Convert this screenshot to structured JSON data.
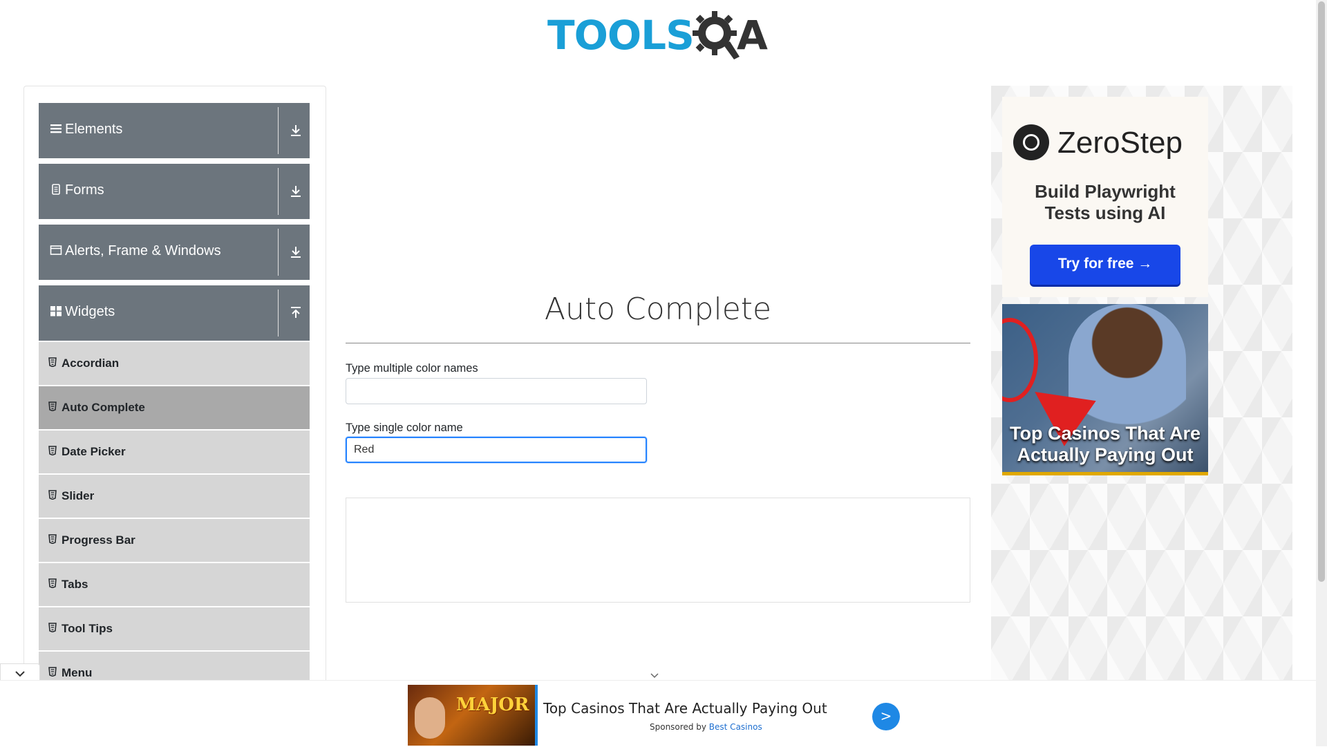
{
  "header": {
    "logo_text": "TOOLS",
    "logo_suffix": "A"
  },
  "sidebar": {
    "groups": [
      {
        "label": "Elements",
        "icon": "hamburger-icon",
        "expanded": false
      },
      {
        "label": "Forms",
        "icon": "document-icon",
        "expanded": false
      },
      {
        "label": "Alerts, Frame & Windows",
        "icon": "window-icon",
        "expanded": false
      },
      {
        "label": "Widgets",
        "icon": "grid-icon",
        "expanded": true
      }
    ],
    "items": [
      {
        "label": "Accordian",
        "active": false
      },
      {
        "label": "Auto Complete",
        "active": true
      },
      {
        "label": "Date Picker",
        "active": false
      },
      {
        "label": "Slider",
        "active": false
      },
      {
        "label": "Progress Bar",
        "active": false
      },
      {
        "label": "Tabs",
        "active": false
      },
      {
        "label": "Tool Tips",
        "active": false
      },
      {
        "label": "Menu",
        "active": false
      }
    ]
  },
  "main": {
    "title": "Auto Complete",
    "multi": {
      "label": "Type multiple color names",
      "value": ""
    },
    "single": {
      "label": "Type single color name",
      "value": "Red"
    }
  },
  "right_ads": {
    "zerostep": {
      "name": "ZeroStep",
      "tagline_line1": "Build Playwright",
      "tagline_line2": "Tests using AI",
      "button": "Try for free →"
    },
    "casino": {
      "line1": "Top Casinos That Are",
      "line2": "Actually Paying Out"
    }
  },
  "bottom_ad": {
    "thumb_text": "MAJOR",
    "title": "Top Casinos That Are Actually Paying Out",
    "sponsored_prefix": "Sponsored by",
    "sponsor": "Best Casinos",
    "go_label": ">"
  },
  "colors": {
    "brand_blue": "#1a9fd7",
    "sidebar_group": "#6c757d",
    "sidebar_item": "#d6d6d6",
    "sidebar_active": "#a9a9a9",
    "focus": "#2684ff"
  }
}
